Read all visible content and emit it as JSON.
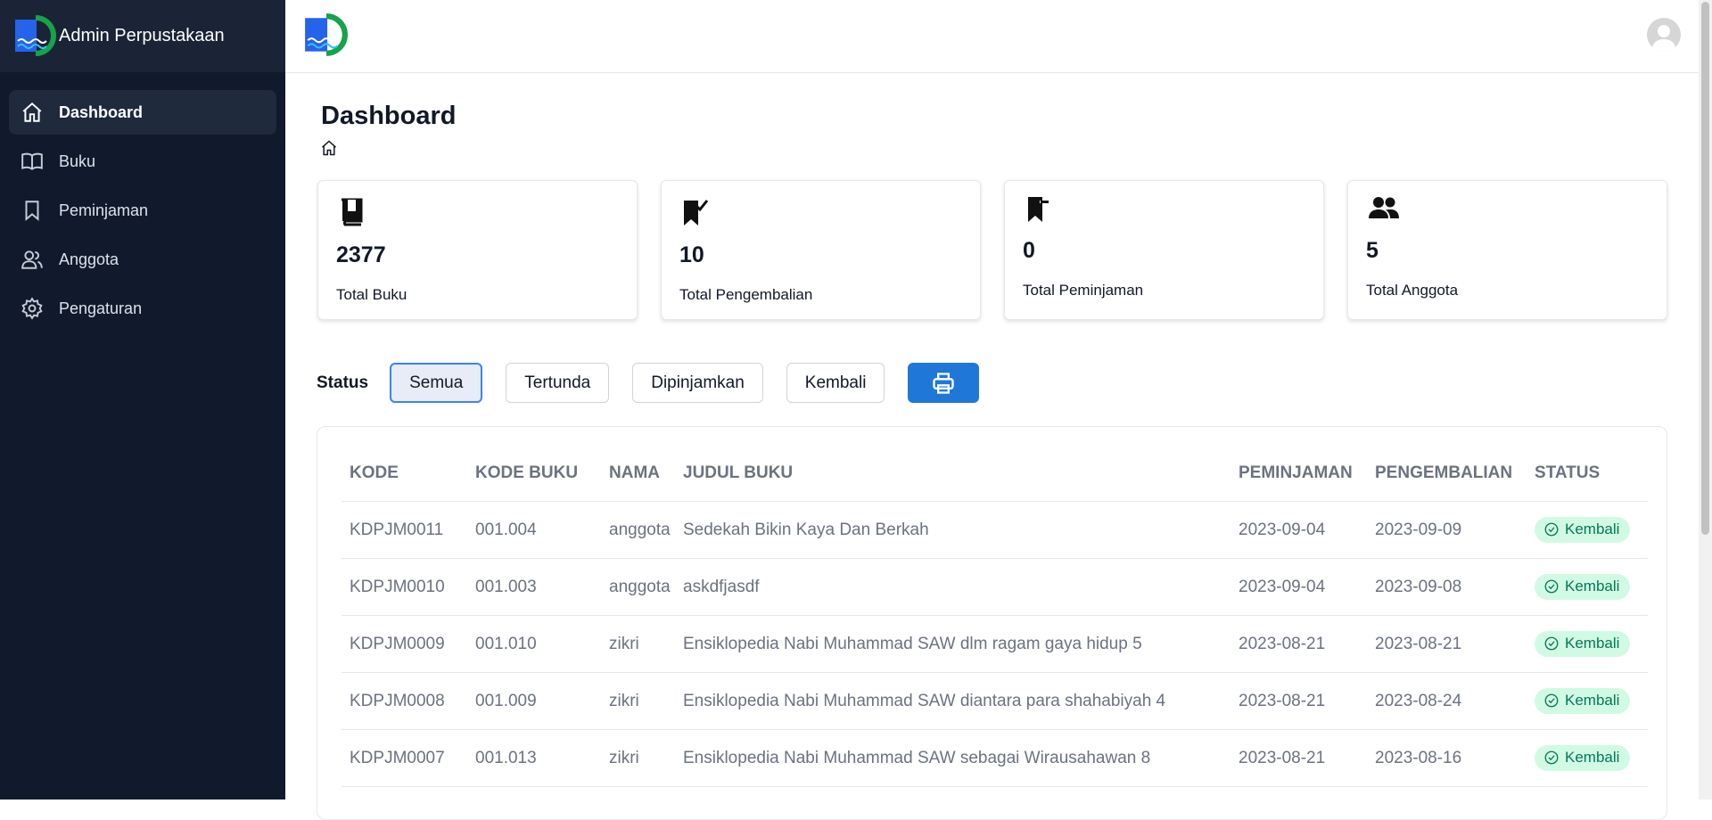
{
  "app": {
    "title": "Admin Perpustakaan"
  },
  "sidebar": {
    "items": [
      {
        "label": "Dashboard",
        "icon": "home-icon",
        "active": true
      },
      {
        "label": "Buku",
        "icon": "book-open-icon"
      },
      {
        "label": "Peminjaman",
        "icon": "bookmark-icon"
      },
      {
        "label": "Anggota",
        "icon": "users-icon"
      },
      {
        "label": "Pengaturan",
        "icon": "gear-icon"
      }
    ]
  },
  "page": {
    "title": "Dashboard"
  },
  "stats": [
    {
      "value": "2377",
      "label": "Total Buku",
      "icon": "book-icon"
    },
    {
      "value": "10",
      "label": "Total Pengembalian",
      "icon": "bookmark-check-icon"
    },
    {
      "value": "0",
      "label": "Total Peminjaman",
      "icon": "bookmark-minus-icon"
    },
    {
      "value": "5",
      "label": "Total Anggota",
      "icon": "users-icon"
    }
  ],
  "filter": {
    "label": "Status",
    "options": [
      "Semua",
      "Tertunda",
      "Dipinjamkan",
      "Kembali"
    ],
    "selected": "Semua"
  },
  "table": {
    "headers": [
      "KODE",
      "KODE BUKU",
      "NAMA",
      "JUDUL BUKU",
      "PEMINJAMAN",
      "PENGEMBALIAN",
      "STATUS"
    ],
    "rows": [
      [
        "KDPJM0011",
        "001.004",
        "anggota",
        "Sedekah Bikin Kaya Dan Berkah",
        "2023-09-04",
        "2023-09-09",
        "Kembali"
      ],
      [
        "KDPJM0010",
        "001.003",
        "anggota",
        "askdfjasdf",
        "2023-09-04",
        "2023-09-08",
        "Kembali"
      ],
      [
        "KDPJM0009",
        "001.010",
        "zikri",
        "Ensiklopedia Nabi Muhammad SAW dlm ragam gaya hidup 5",
        "2023-08-21",
        "2023-08-21",
        "Kembali"
      ],
      [
        "KDPJM0008",
        "001.009",
        "zikri",
        "Ensiklopedia Nabi Muhammad SAW diantara para shahabiyah 4",
        "2023-08-21",
        "2023-08-24",
        "Kembali"
      ],
      [
        "KDPJM0007",
        "001.013",
        "zikri",
        "Ensiklopedia Nabi Muhammad SAW sebagai Wirausahawan 8",
        "2023-08-21",
        "2023-08-16",
        "Kembali"
      ]
    ]
  },
  "colors": {
    "sidebar": "#111a2c",
    "accent": "#1f78d8",
    "badge_bg": "#d1fae5",
    "badge_text": "#047857"
  }
}
